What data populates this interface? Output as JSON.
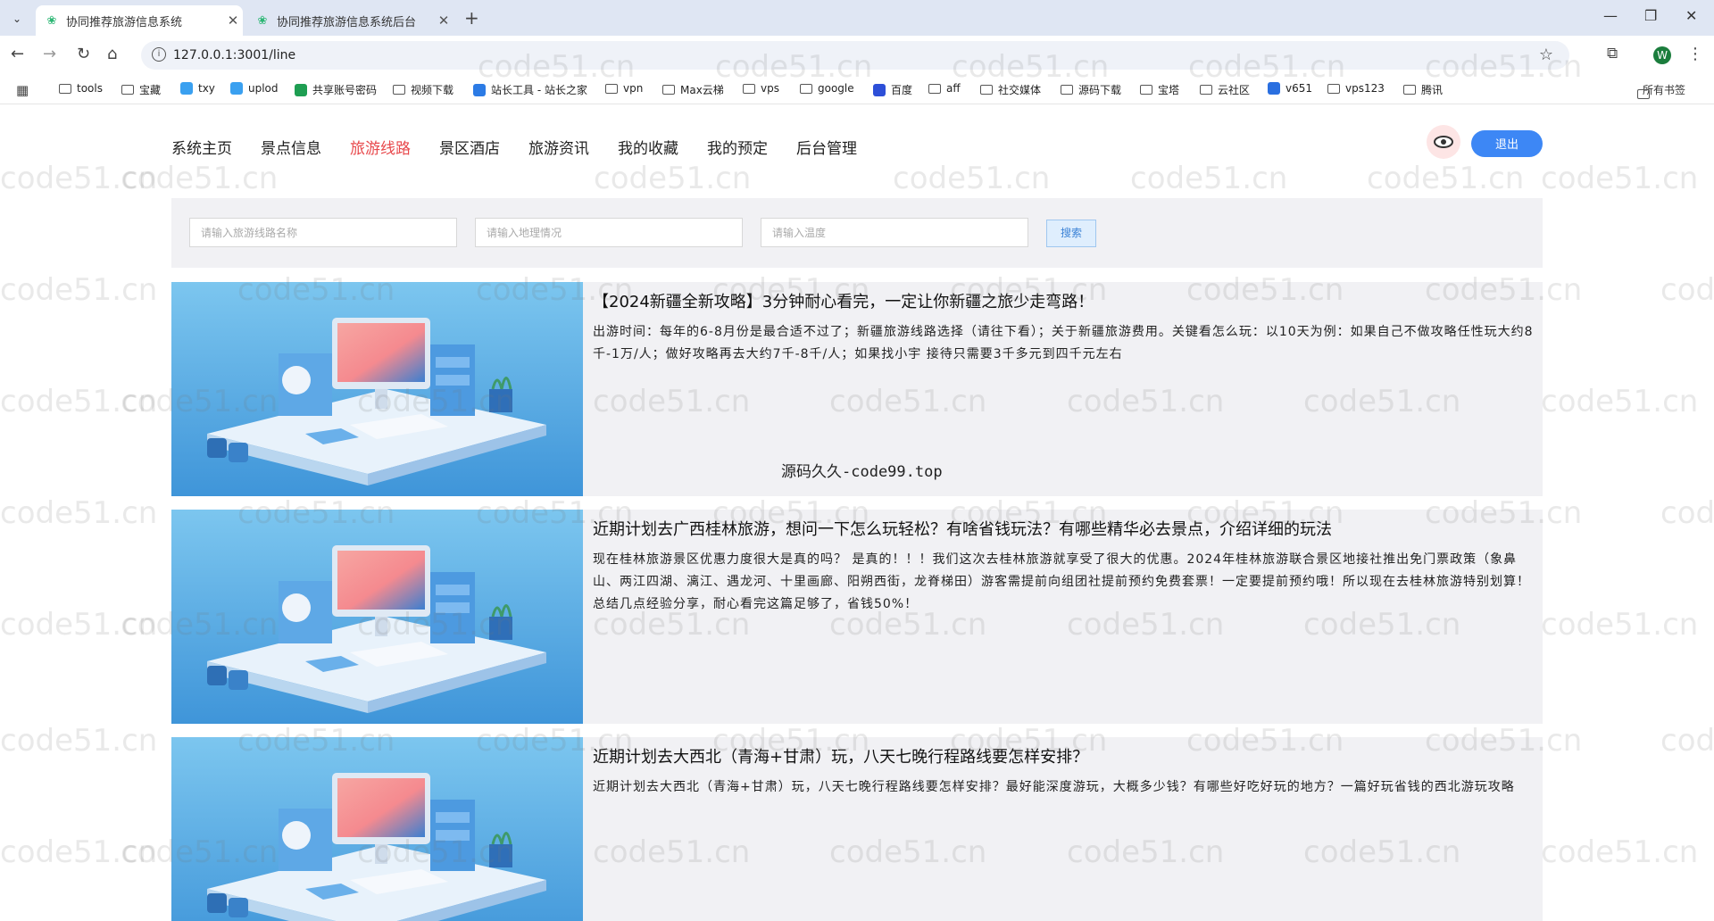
{
  "browser": {
    "tabs": [
      {
        "title": "协同推荐旅游信息系统",
        "active": true
      },
      {
        "title": "协同推荐旅游信息系统后台",
        "active": false
      }
    ],
    "url": "127.0.0.1:3001/line",
    "profile_initial": "W",
    "bookmarks": [
      {
        "label": "tools",
        "icon": "folder-icon"
      },
      {
        "label": "宝藏",
        "icon": "folder-icon"
      },
      {
        "label": "txy",
        "icon": "cloud-icon"
      },
      {
        "label": "uplod",
        "icon": "cloud-icon"
      },
      {
        "label": "共享账号密码",
        "icon": "sheet-icon"
      },
      {
        "label": "视频下载",
        "icon": "folder-icon"
      },
      {
        "label": "站长工具 - 站长之家",
        "icon": "site-icon"
      },
      {
        "label": "vpn",
        "icon": "folder-icon"
      },
      {
        "label": "Max云梯",
        "icon": "folder-icon"
      },
      {
        "label": "vps",
        "icon": "folder-icon"
      },
      {
        "label": "google",
        "icon": "folder-icon"
      },
      {
        "label": "百度",
        "icon": "baidu-icon"
      },
      {
        "label": "aff",
        "icon": "folder-icon"
      },
      {
        "label": "社交媒体",
        "icon": "folder-icon"
      },
      {
        "label": "源码下载",
        "icon": "folder-icon"
      },
      {
        "label": "宝塔",
        "icon": "folder-icon"
      },
      {
        "label": "云社区",
        "icon": "folder-icon"
      },
      {
        "label": "v651",
        "icon": "v-icon"
      },
      {
        "label": "vps123",
        "icon": "folder-icon"
      },
      {
        "label": "腾讯",
        "icon": "folder-icon"
      }
    ],
    "all_bookmarks": "所有书签"
  },
  "nav": {
    "items": [
      "系统主页",
      "景点信息",
      "旅游线路",
      "景区酒店",
      "旅游资讯",
      "我的收藏",
      "我的预定",
      "后台管理"
    ],
    "active_index": 2,
    "logout": "退出"
  },
  "search": {
    "name_placeholder": "请输入旅游线路名称",
    "geo_placeholder": "请输入地理情况",
    "temp_placeholder": "请输入温度",
    "button": "搜索"
  },
  "cards": [
    {
      "title": "【2024新疆全新攻略】3分钟耐心看完，一定让你新疆之旅少走弯路！",
      "desc": "出游时间：每年的6-8月份是最合适不过了；新疆旅游线路选择（请往下看）；关于新疆旅游费用。关键看怎么玩：以10天为例：如果自己不做攻略任性玩大约8千-1万/人；做好攻略再去大约7千-8千/人；如果找小宇 接待只需要3千多元到四千元左右"
    },
    {
      "title": "近期计划去广西桂林旅游，想问一下怎么玩轻松？有啥省钱玩法？有哪些精华必去景点，介绍详细的玩法",
      "desc": "现在桂林旅游景区优惠力度很大是真的吗？ 是真的！！！我们这次去桂林旅游就享受了很大的优惠。2024年桂林旅游联合景区地接社推出免门票政策（象鼻山、两江四湖、漓江、遇龙河、十里画廊、阳朔西街，龙脊梯田）游客需提前向组团社提前预约免费套票！一定要提前预约哦！所以现在去桂林旅游特别划算！总结几点经验分享，耐心看完这篇足够了，省钱50%！"
    },
    {
      "title": "近期计划去大西北（青海+甘肃）玩，八天七晚行程路线要怎样安排？",
      "desc": "近期计划去大西北（青海+甘肃）玩，八天七晚行程路线要怎样安排？最好能深度游玩，大概多少钱？有哪些好吃好玩的地方？一篇好玩省钱的西北游玩攻略"
    }
  ],
  "notice": "源码久久-code99.top",
  "watermark": "code51.cn"
}
